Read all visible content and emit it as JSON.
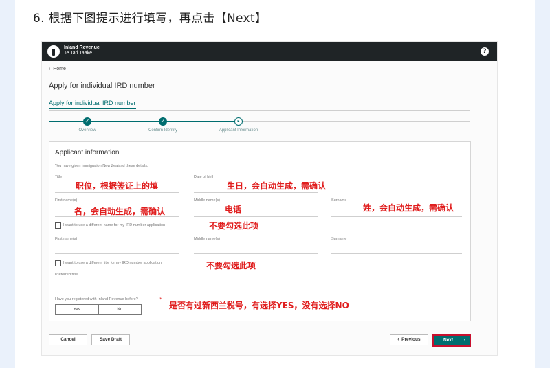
{
  "instruction": "6. 根据下图提示进行填写，再点击【Next】",
  "app": {
    "brand_line1": "Inland Revenue",
    "brand_line2": "Te Tari Taake",
    "help_label": "?"
  },
  "breadcrumb": "Home",
  "page_title": "Apply for individual IRD number",
  "tab_label": "Apply for individual IRD number",
  "progress": {
    "steps": [
      {
        "label": "Overview",
        "state": "done"
      },
      {
        "label": "Confirm Identity",
        "state": "done"
      },
      {
        "label": "Applicant Information",
        "state": "current"
      }
    ]
  },
  "form": {
    "heading": "Applicant information",
    "intro": "You have given Immigration New Zealand these details.",
    "labels": {
      "title": "Title",
      "dob": "Date of birth",
      "first_names": "First name(s)",
      "middle_names": "Middle name(s)",
      "surname": "Surname",
      "diff_name": "I want to use a different name for my IRD number application",
      "diff_title": "I want to use a different title for my IRD number application",
      "preferred_title": "Preferred title",
      "registered_q": "Have you registered with Inland Revenue before?"
    },
    "yes_label": "Yes",
    "no_label": "No"
  },
  "annotations": {
    "title": "职位，根据签证上的填",
    "dob": "生日，会自动生成，需确认",
    "first": "名，会自动生成，需确认",
    "middle": "电话",
    "surname": "姓，会自动生成，需确认",
    "no_check1": "不要勾选此项",
    "no_check2": "不要勾选此项",
    "registered": "是否有过新西兰税号，有选择YES，没有选择NO"
  },
  "buttons": {
    "cancel": "Cancel",
    "save_draft": "Save Draft",
    "previous": "Previous",
    "next": "Next"
  },
  "colors": {
    "teal": "#006d6f",
    "annotation_red": "#e01e1e",
    "topbar": "#1f2426"
  }
}
